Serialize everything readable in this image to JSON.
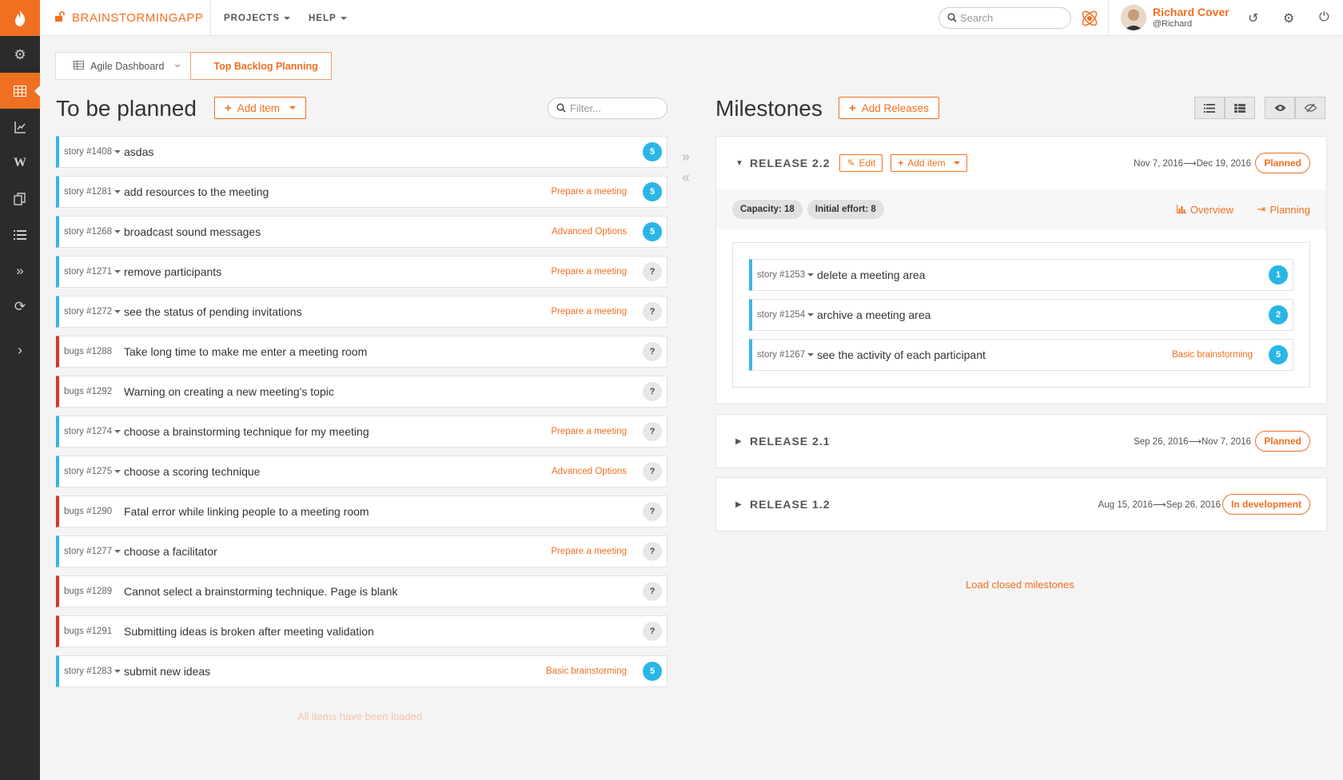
{
  "brand": {
    "name": "BRAINSTORMINGAPP"
  },
  "nav": {
    "projects": "PROJECTS",
    "help": "HELP"
  },
  "search": {
    "placeholder": "Search"
  },
  "user": {
    "name": "Richard Cover",
    "handle": "@Richard"
  },
  "breadcrumb": {
    "dashboard": "Agile Dashboard",
    "current": "Top Backlog Planning"
  },
  "left": {
    "title": "To be planned",
    "add_item": "Add item",
    "filter_placeholder": "Filter...",
    "items": [
      {
        "type": "story",
        "id": "story #1408",
        "title": "asdas",
        "tag": "",
        "points": "5"
      },
      {
        "type": "story",
        "id": "story #1281",
        "title": "add resources to the meeting",
        "tag": "Prepare a meeting",
        "points": "5"
      },
      {
        "type": "story",
        "id": "story #1268",
        "title": "broadcast sound messages",
        "tag": "Advanced Options",
        "points": "5"
      },
      {
        "type": "story",
        "id": "story #1271",
        "title": "remove participants",
        "tag": "Prepare a meeting",
        "points": "?"
      },
      {
        "type": "story",
        "id": "story #1272",
        "title": "see the status of pending invitations",
        "tag": "Prepare a meeting",
        "points": "?"
      },
      {
        "type": "bug",
        "id": "bugs #1288",
        "title": "Take long time to make me enter a meeting room",
        "tag": "",
        "points": "?"
      },
      {
        "type": "bug",
        "id": "bugs #1292",
        "title": "Warning on creating a new meeting's topic",
        "tag": "",
        "points": "?"
      },
      {
        "type": "story",
        "id": "story #1274",
        "title": "choose a brainstorming technique for my meeting",
        "tag": "Prepare a meeting",
        "points": "?"
      },
      {
        "type": "story",
        "id": "story #1275",
        "title": "choose a scoring technique",
        "tag": "Advanced Options",
        "points": "?"
      },
      {
        "type": "bug",
        "id": "bugs #1290",
        "title": "Fatal error while linking people to a meeting room",
        "tag": "",
        "points": "?"
      },
      {
        "type": "story",
        "id": "story #1277",
        "title": "choose a facilitator",
        "tag": "Prepare a meeting",
        "points": "?"
      },
      {
        "type": "bug",
        "id": "bugs #1289",
        "title": "Cannot select a brainstorming technique. Page is blank",
        "tag": "",
        "points": "?"
      },
      {
        "type": "bug",
        "id": "bugs #1291",
        "title": "Submitting ideas is broken after meeting validation",
        "tag": "",
        "points": "?"
      },
      {
        "type": "story",
        "id": "story #1283",
        "title": "submit new ideas",
        "tag": "Basic brainstorming",
        "points": "5"
      }
    ],
    "footer": "All items have been loaded"
  },
  "right": {
    "title": "Milestones",
    "add_releases": "Add Releases",
    "releases": [
      {
        "name": "RELEASE 2.2",
        "edit": "Edit",
        "add_item": "Add item",
        "start": "Nov 7, 2016",
        "end": "Dec 19, 2016",
        "status": "Planned",
        "capacity": "Capacity: 18",
        "effort": "Initial effort: 8",
        "overview": "Overview",
        "planning": "Planning",
        "items": [
          {
            "id": "story #1253",
            "title": "delete a meeting area",
            "tag": "",
            "points": "1"
          },
          {
            "id": "story #1254",
            "title": "archive a meeting area",
            "tag": "",
            "points": "2"
          },
          {
            "id": "story #1267",
            "title": "see the activity of each participant",
            "tag": "Basic brainstorming",
            "points": "5"
          }
        ]
      },
      {
        "name": "RELEASE 2.1",
        "start": "Sep 26, 2016",
        "end": "Nov 7, 2016",
        "status": "Planned"
      },
      {
        "name": "RELEASE 1.2",
        "start": "Aug 15, 2016",
        "end": "Sep 26, 2016",
        "status": "In development"
      }
    ],
    "load_closed": "Load closed milestones"
  },
  "colors": {
    "accent": "#f07022",
    "story": "#34b7e3",
    "bug": "#d9342b",
    "points": "#29b6e6",
    "sidebar": "#2b2b2b"
  },
  "icons": [
    "brand-flame-icon",
    "gears-icon",
    "table-icon",
    "chart-icon",
    "wiki-icon",
    "copy-icon",
    "list-icon",
    "double-chevron-icon",
    "refresh-icon",
    "chevron-right-icon",
    "search-icon",
    "atom-icon",
    "history-icon",
    "gear-icon",
    "power-icon"
  ]
}
